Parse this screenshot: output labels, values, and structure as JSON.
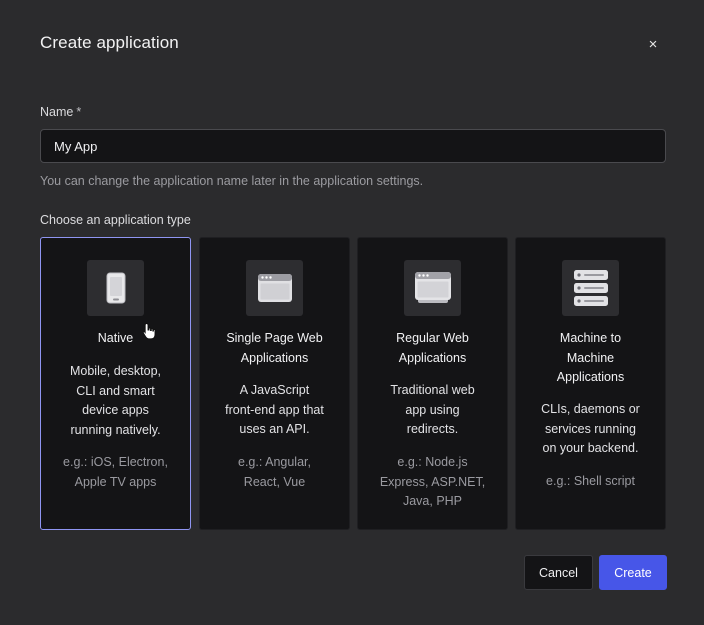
{
  "dialog": {
    "title": "Create application",
    "close_symbol": "×"
  },
  "name_field": {
    "label": "Name",
    "required_mark": "*",
    "value": "My App",
    "helper": "You can change the application name later in the application settings."
  },
  "app_type": {
    "label": "Choose an application type",
    "selected_index": 0,
    "options": [
      {
        "title": "Native",
        "description": "Mobile, desktop,\nCLI and smart\ndevice apps\nrunning natively.",
        "examples": "e.g.: iOS, Electron,\nApple TV apps",
        "icon": "mobile-phone-icon"
      },
      {
        "title": "Single Page Web\nApplications",
        "description": "A JavaScript\nfront-end app that\nuses an API.",
        "examples": "e.g.: Angular,\nReact, Vue",
        "icon": "browser-window-icon"
      },
      {
        "title": "Regular Web\nApplications",
        "description": "Traditional web\napp using\nredirects.",
        "examples": "e.g.: Node.js\nExpress, ASP.NET,\nJava, PHP",
        "icon": "stacked-browser-icon"
      },
      {
        "title": "Machine to\nMachine\nApplications",
        "description": "CLIs, daemons or\nservices running\non your backend.",
        "examples": "e.g.: Shell script",
        "icon": "server-stack-icon"
      }
    ]
  },
  "actions": {
    "cancel_label": "Cancel",
    "create_label": "Create"
  },
  "colors": {
    "accent": "#4756e8",
    "selected_border": "#8f95f2",
    "dialog_bg": "#2b2b2d",
    "card_bg": "#141416"
  }
}
